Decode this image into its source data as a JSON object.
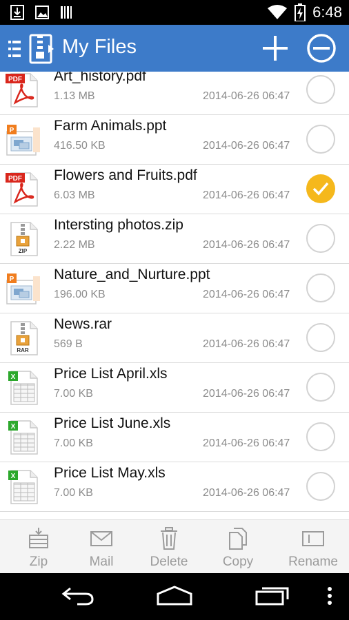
{
  "status_bar": {
    "time": "6:48",
    "icons": [
      "download-icon",
      "image-icon",
      "barcode-icon",
      "wifi-icon",
      "battery-charging-icon"
    ]
  },
  "app_bar": {
    "title": "My Files",
    "color": "#3d7bc9",
    "icons": [
      "drawer-menu-icon",
      "zip-logo-icon",
      "add-icon",
      "remove-icon"
    ]
  },
  "files": [
    {
      "name": "Art_history.pdf",
      "size": "1.13 MB",
      "date": "2014-06-26 06:47",
      "type": "pdf",
      "checked": false
    },
    {
      "name": "Farm Animals.ppt",
      "size": "416.50 KB",
      "date": "2014-06-26 06:47",
      "type": "ppt",
      "checked": false
    },
    {
      "name": "Flowers and Fruits.pdf",
      "size": "6.03 MB",
      "date": "2014-06-26 06:47",
      "type": "pdf",
      "checked": true
    },
    {
      "name": "Intersting photos.zip",
      "size": "2.22 MB",
      "date": "2014-06-26 06:47",
      "type": "zip",
      "checked": false
    },
    {
      "name": "Nature_and_Nurture.ppt",
      "size": "196.00 KB",
      "date": "2014-06-26 06:47",
      "type": "ppt",
      "checked": false
    },
    {
      "name": "News.rar",
      "size": "569 B",
      "date": "2014-06-26 06:47",
      "type": "rar",
      "checked": false
    },
    {
      "name": "Price List April.xls",
      "size": "7.00 KB",
      "date": "2014-06-26 06:47",
      "type": "xls",
      "checked": false
    },
    {
      "name": "Price List June.xls",
      "size": "7.00 KB",
      "date": "2014-06-26 06:47",
      "type": "xls",
      "checked": false
    },
    {
      "name": "Price List May.xls",
      "size": "7.00 KB",
      "date": "2014-06-26 06:47",
      "type": "xls",
      "checked": false
    }
  ],
  "file_icon_labels": {
    "pdf": "PDF",
    "zip": "ZIP",
    "rar": "RAR",
    "ppt": "P",
    "xls": "X"
  },
  "toolbar": {
    "zip": "Zip",
    "mail": "Mail",
    "delete": "Delete",
    "copy": "Copy",
    "rename": "Rename"
  },
  "nav_bar": {
    "icons": [
      "back-icon",
      "home-icon",
      "recent-apps-icon",
      "overflow-menu-icon"
    ]
  },
  "colors": {
    "accent": "#3d7bc9",
    "checked": "#f5b81c",
    "secondary_text": "#8c8c8c"
  }
}
